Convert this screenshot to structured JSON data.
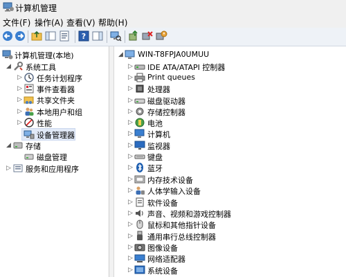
{
  "window": {
    "title": "计算机管理"
  },
  "menu": [
    "文件(F)",
    "操作(A)",
    "查看(V)",
    "帮助(H)"
  ],
  "toolbar": [
    "back-icon",
    "forward-icon",
    "up-folder-icon",
    "show-tree-icon",
    "properties-icon",
    "help-icon",
    "action-pane-icon",
    "scan-hardware-icon",
    "update-driver-icon",
    "disable-device-icon",
    "uninstall-device-icon"
  ],
  "left_tree": {
    "root": "计算机管理(本地)",
    "system_tools": "系统工具",
    "system_children": [
      "任务计划程序",
      "事件查看器",
      "共享文件夹",
      "本地用户和组",
      "性能",
      "设备管理器"
    ],
    "storage": "存储",
    "storage_children": [
      "磁盘管理"
    ],
    "services": "服务和应用程序"
  },
  "device_tree": {
    "computer_name": "WIN-T8FPJA0UMUU",
    "categories": [
      "IDE ATA/ATAPI 控制器",
      "Print queues",
      "处理器",
      "磁盘驱动器",
      "存储控制器",
      "电池",
      "计算机",
      "监视器",
      "键盘",
      "蓝牙",
      "内存技术设备",
      "人体学输入设备",
      "软件设备",
      "声音、视频和游戏控制器",
      "鼠标和其他指针设备",
      "通用串行总线控制器",
      "图像设备",
      "网络适配器",
      "系统设备"
    ]
  }
}
